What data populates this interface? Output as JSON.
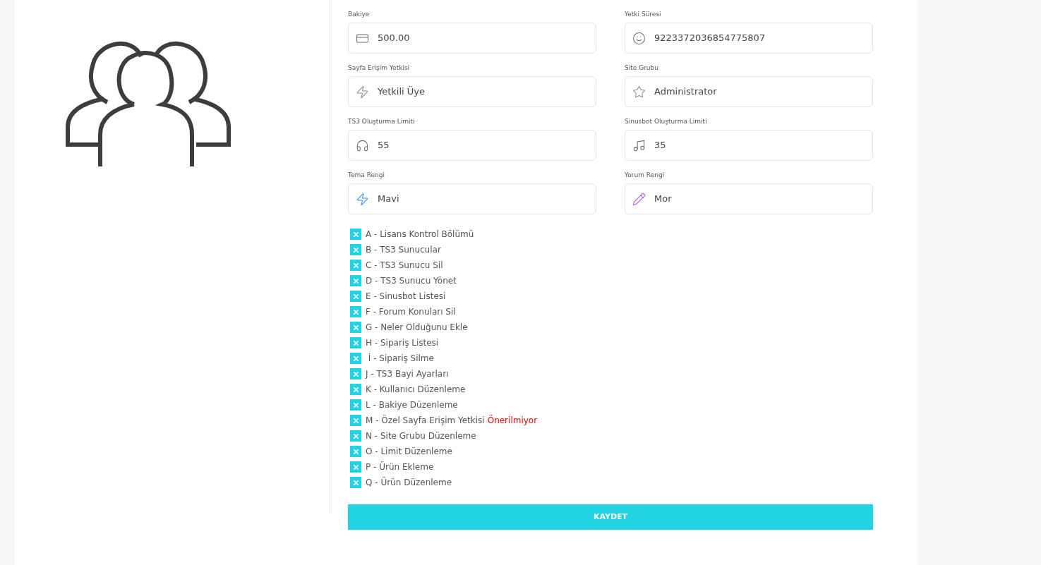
{
  "fields": [
    {
      "label": "Bakiye",
      "value": "500.00"
    },
    {
      "label": "Yetki Süresi",
      "value": "9223372036854775807"
    },
    {
      "label": "Sayfa Erişim Yetkisi",
      "value": "Yetkili Üye"
    },
    {
      "label": "Site Grubu",
      "value": "Administrator"
    },
    {
      "label": "TS3 Oluşturma Limiti",
      "value": "55"
    },
    {
      "label": "Sinusbot Oluşturma Limiti",
      "value": "35"
    },
    {
      "label": "Tema Rengi",
      "value": "Mavi"
    },
    {
      "label": "Yorum Rengi",
      "value": "Mor"
    }
  ],
  "permissions": [
    {
      "label": "A - Lisans Kontrol Bölümü",
      "checked": true
    },
    {
      "label": "B - TS3 Sunucular",
      "checked": true
    },
    {
      "label": "C - TS3 Sunucu Sil",
      "checked": true
    },
    {
      "label": "D - TS3 Sunucu Yönet",
      "checked": true
    },
    {
      "label": "E - Sinusbot Listesi",
      "checked": true
    },
    {
      "label": "F - Forum Konuları Sil",
      "checked": true
    },
    {
      "label": "G - Neler Olduğunu Ekle",
      "checked": true
    },
    {
      "label": "H - Sipariş Listesi",
      "checked": true
    },
    {
      "label": " İ - Sipariş Silme",
      "checked": true
    },
    {
      "label": "J - TS3 Bayi Ayarları",
      "checked": true
    },
    {
      "label": "K - Kullanıcı Düzenleme",
      "checked": true
    },
    {
      "label": "L - Bakiye Düzenleme",
      "checked": true
    },
    {
      "label": "M - Özel Sayfa Erişim Yetkisi",
      "warning": "Önerilmiyor",
      "checked": true
    },
    {
      "label": "N - Site Grubu Düzenleme",
      "checked": true
    },
    {
      "label": "O - Limit Düzenleme",
      "checked": true
    },
    {
      "label": "P - Ürün Ekleme",
      "checked": true
    },
    {
      "label": "Q - Ürün Düzenleme",
      "checked": true
    }
  ],
  "save_button": "KAYDET"
}
